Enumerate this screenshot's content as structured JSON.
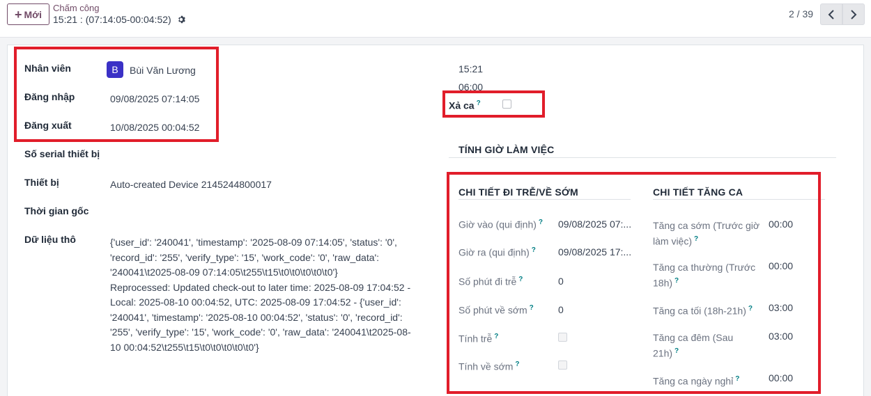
{
  "toolbar": {
    "new_label": "Mới",
    "breadcrumb_parent": "Chấm công",
    "breadcrumb_current": "15:21 : (07:14:05-00:04:52)",
    "pager": "2 / 39"
  },
  "left": {
    "employee_label": "Nhân viên",
    "employee_initial": "B",
    "employee_name": "Bùi Văn Lương",
    "check_in_label": "Đăng nhập",
    "check_in_value": "09/08/2025 07:14:05",
    "check_out_label": "Đăng xuất",
    "check_out_value": "10/08/2025 00:04:52",
    "serial_label": "Số serial thiết bị",
    "device_label": "Thiết bị",
    "device_value": "Auto-created Device 2145244800017",
    "origin_time_label": "Thời gian gốc",
    "raw_label": "Dữ liệu thô",
    "raw_value": "{'user_id': '240041', 'timestamp': '2025-08-09 07:14:05', 'status': '0',\n'record_id': '255', 'verify_type': '15', 'work_code': '0', 'raw_data':\n'240041\\t2025-08-09 07:14:05\\t255\\t15\\t0\\t0\\t0\\t0\\t0'}\nReprocessed: Updated check-out to later time: 2025-08-09 17:04:52 -\nLocal: 2025-08-10 00:04:52, UTC: 2025-08-09 17:04:52 - {'user_id':\n'240041', 'timestamp': '2025-08-10 00:04:52', 'status': '0', 'record_id':\n'255', 'verify_type': '15', 'work_code': '0', 'raw_data': '240041\\t2025-08-\n10 00:04:52\\t255\\t15\\t0\\t0\\t0\\t0\\t0'}"
  },
  "right": {
    "worked_hours": "15:21",
    "extra_hours": "06:00",
    "shift_release_label": "Xả ca",
    "section_title": "TÍNH GIỜ LÀM VIỆC",
    "late_section_title": "CHI TIẾT ĐI TRỄ/VỀ SỚM",
    "late_rows": [
      {
        "label": "Giờ vào (qui định)",
        "value": "09/08/2025 07:..."
      },
      {
        "label": "Giờ ra (qui định)",
        "value": "09/08/2025 17:..."
      },
      {
        "label": "Số phút đi trễ",
        "value": "0"
      },
      {
        "label": "Số phút về sớm",
        "value": "0"
      },
      {
        "label": "Tính trễ",
        "value": ""
      },
      {
        "label": "Tính về sớm",
        "value": ""
      }
    ],
    "overtime_section_title": "CHI TIẾT TĂNG CA",
    "overtime_rows": [
      {
        "label_line1": "Tăng ca sớm (Trước giờ",
        "label_line2": "làm việc)",
        "value": "00:00"
      },
      {
        "label_line1": "Tăng ca thường (Trước",
        "label_line2": "18h)",
        "value": "00:00"
      },
      {
        "label_line1": "Tăng ca tối (18h-21h)",
        "label_line2": "",
        "value": "03:00"
      },
      {
        "label_line1": "Tăng ca đêm (Sau",
        "label_line2": "21h)",
        "value": "03:00"
      },
      {
        "label_line1": "Tăng ca ngày nghỉ",
        "label_line2": "",
        "value": "00:00"
      }
    ]
  },
  "colors": {
    "brand": "#714b67",
    "highlight_box": "#e11d2a",
    "avatar": "#3b31c6",
    "help_marker": "#017e84"
  }
}
